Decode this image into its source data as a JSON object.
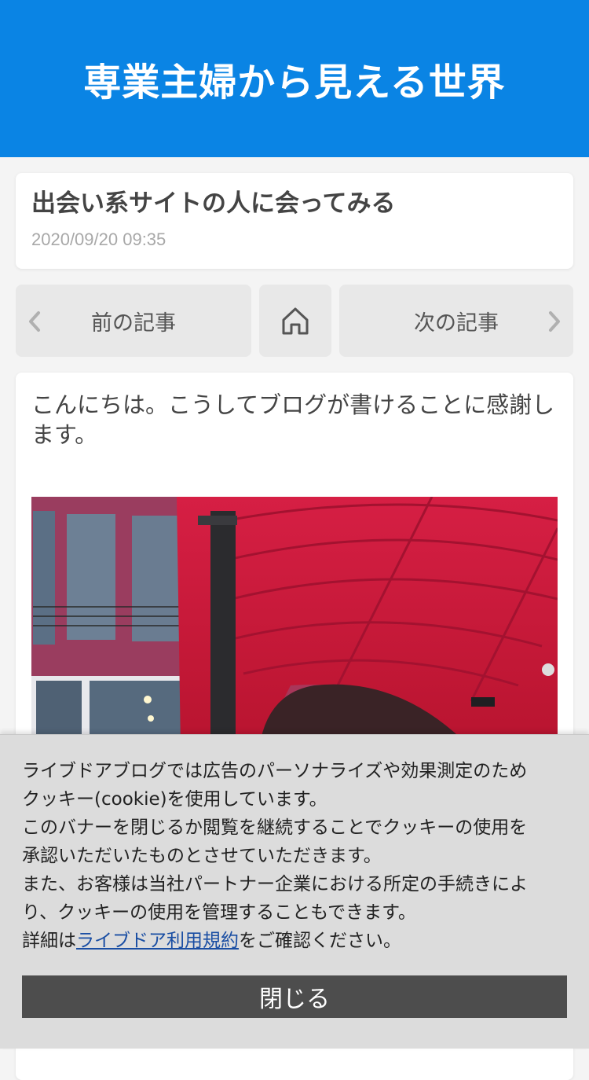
{
  "header": {
    "blog_title": "専業主婦から見える世界"
  },
  "post": {
    "title": "出会い系サイトの人に会ってみる",
    "date": "2020/09/20 09:35",
    "body_text": "こんにちは。こうしてブログが書けることに感謝します。"
  },
  "nav": {
    "prev_label": "前の記事",
    "next_label": "次の記事",
    "home_icon": "home-icon"
  },
  "cookie_banner": {
    "line1": "ライブドアブログでは広告のパーソナライズや効果測定のため",
    "line2": "クッキー(cookie)を使用しています。",
    "line3": "このバナーを閉じるか閲覧を継続することでクッキーの使用を",
    "line4": "承認いただいたものとさせていただきます。",
    "line5": "また、お客様は当社パートナー企業における所定の手続きによ",
    "line6": "り、クッキーの使用を管理することもできます。",
    "detail_prefix": "詳細は",
    "detail_link": "ライブドア利用規約",
    "detail_suffix": "をご確認ください。",
    "close_label": "閉じる"
  },
  "colors": {
    "header_bg": "#0a84e4",
    "link": "#1a4ea3",
    "close_bg": "#4d4d4d"
  }
}
